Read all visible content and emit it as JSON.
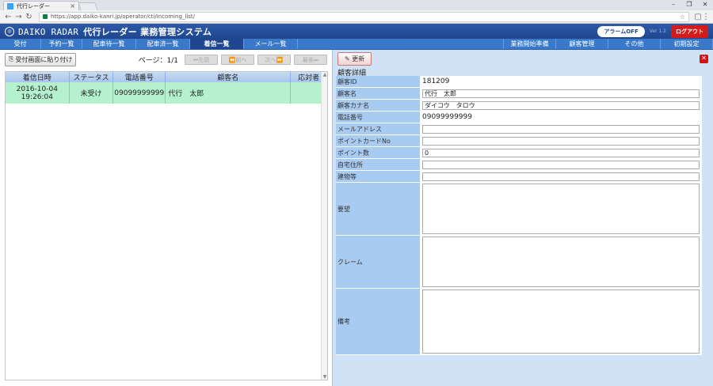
{
  "browser": {
    "tab_title": "代行レーダー",
    "url": "https://app.daiko-kanri.jp/operator/cti/incoming_list/"
  },
  "header": {
    "brand_en": "DAIKO RADAR",
    "brand_jp": "代行レーダー 業務管理システム",
    "alarm_label": "アラームOFF",
    "version": "Ver 1.2",
    "logout_label": "ログアウト"
  },
  "nav": {
    "left": [
      "受付",
      "予約一覧",
      "配車待一覧",
      "配車済一覧",
      "着信一覧",
      "メール一覧"
    ],
    "active_index": 4,
    "right": [
      "業務開始準備",
      "顧客管理",
      "その他",
      "初期設定"
    ]
  },
  "list": {
    "paste_label": "受付画面に貼り付け",
    "page_label": "ページ：1/1",
    "pager": [
      "⏮先頭",
      "⏪前へ",
      "次へ⏩",
      "最後⏭"
    ],
    "columns": [
      "着信日時",
      "ステータス",
      "電話番号",
      "顧客名",
      "応対者"
    ],
    "rows": [
      {
        "date": "2016-10-04",
        "time": "19:26:04",
        "status": "未受け",
        "phone": "09099999999",
        "name": "代行　太郎",
        "operator": ""
      }
    ]
  },
  "detail": {
    "update_label": "更新",
    "title": "顧客詳細",
    "fields": {
      "id_label": "顧客ID",
      "id_value": "181209",
      "name_label": "顧客名",
      "name_value": "代行　太郎",
      "kana_label": "顧客カナ名",
      "kana_value": "ダイコウ　タロウ",
      "phone_label": "電話番号",
      "phone_value": "09099999999",
      "mail_label": "メールアドレス",
      "mail_value": "",
      "card_label": "ポイントカードNo",
      "card_value": "",
      "points_label": "ポイント数",
      "points_value": "0",
      "address_label": "自宅住所",
      "address_value": "",
      "building_label": "建物等",
      "building_value": "",
      "request_label": "要望",
      "claim_label": "クレーム",
      "note_label": "備考"
    }
  },
  "colors": {
    "header_bg": "#1f4790",
    "nav_bg": "#3a79c9",
    "row_bg": "#b5f0cf",
    "logout_bg": "#d31b1b",
    "label_bg": "#a8cbf1"
  }
}
